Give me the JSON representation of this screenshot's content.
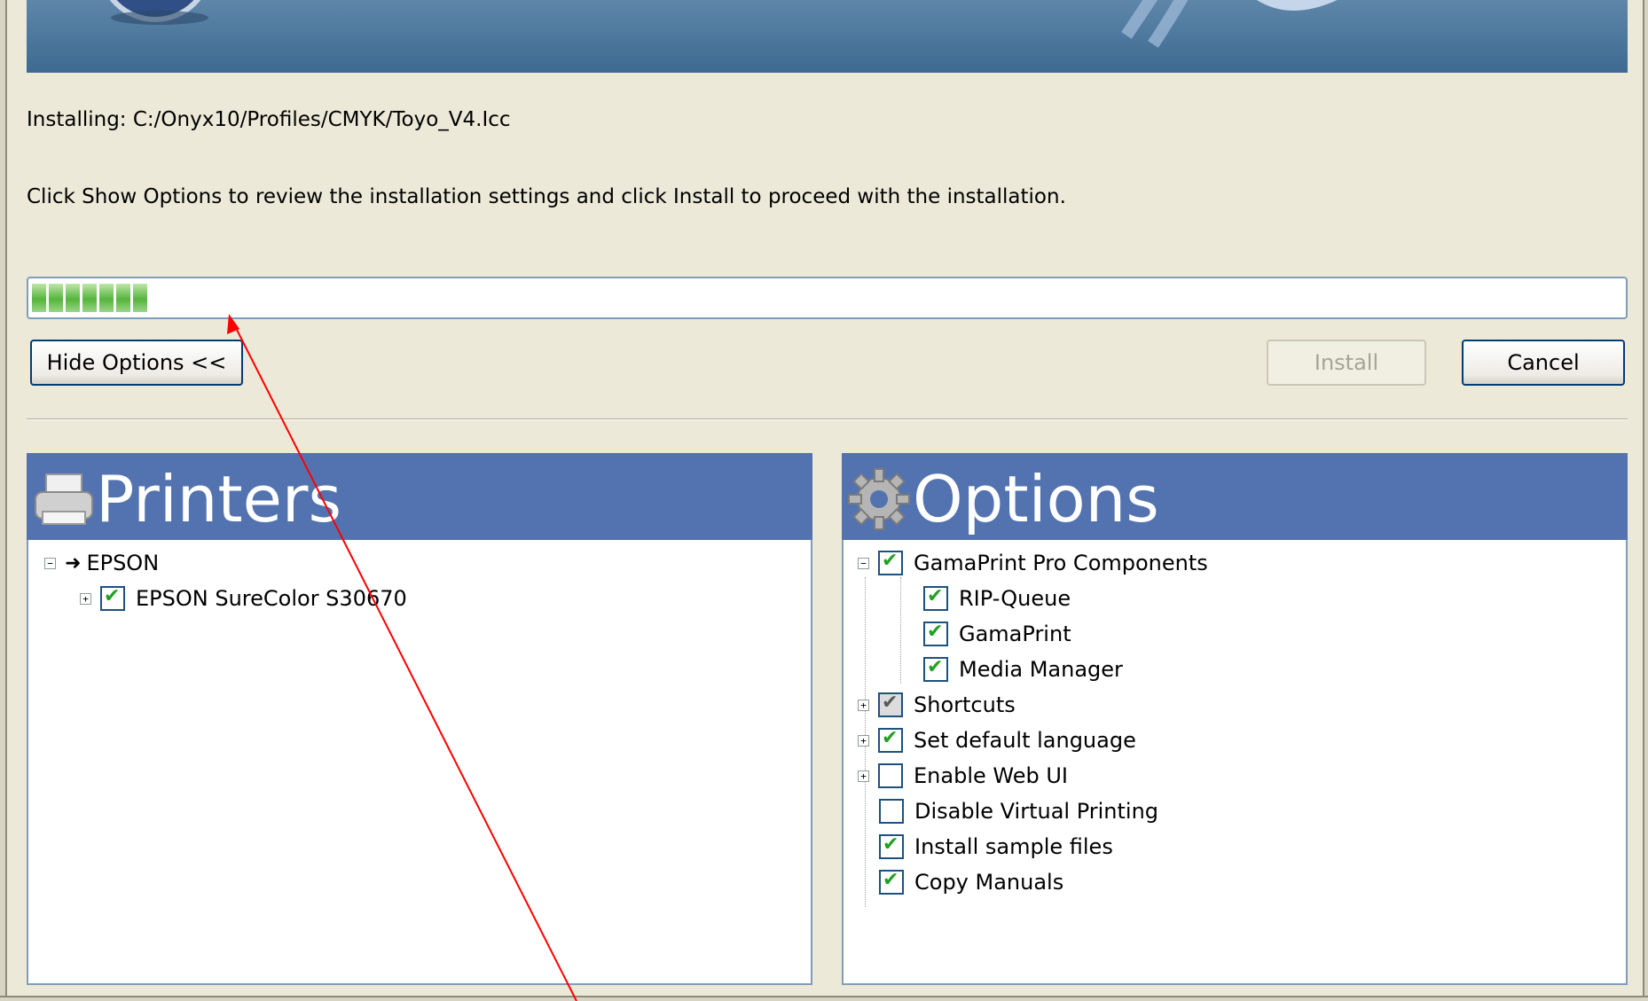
{
  "installing": "Installing: C:/Onyx10/Profiles/CMYK/Toyo_V4.Icc",
  "instructions": "Click Show Options to review the installation settings and click Install to proceed with the installation.",
  "progress": {
    "segments_filled": 7
  },
  "buttons": {
    "hide_options": "Hide Options <<",
    "install": "Install",
    "cancel": "Cancel"
  },
  "printers": {
    "title": "Printers",
    "tree": [
      {
        "label": "EPSON",
        "expander": "−"
      },
      {
        "label": "EPSON SureColor S30670",
        "expander": "+",
        "checked": true
      }
    ]
  },
  "options": {
    "title": "Options",
    "items": [
      {
        "label": "GamaPrint Pro Components",
        "expander": "−",
        "checked": true
      },
      {
        "label": "RIP-Queue",
        "checked": true
      },
      {
        "label": "GamaPrint",
        "checked": true
      },
      {
        "label": "Media Manager",
        "checked": true
      },
      {
        "label": "Shortcuts",
        "expander": "+",
        "state": "partial"
      },
      {
        "label": "Set default language",
        "expander": "+",
        "checked": true
      },
      {
        "label": "Enable Web UI",
        "expander": "+",
        "checked": false
      },
      {
        "label": "Disable Virtual Printing",
        "checked": false
      },
      {
        "label": "Install sample files",
        "checked": true
      },
      {
        "label": "Copy Manuals",
        "checked": true
      }
    ]
  },
  "colors": {
    "banner": "#4a76a0",
    "panel_header": "#5373b0",
    "progress": "#54b53b",
    "annotation_arrow": "#ff0000"
  }
}
